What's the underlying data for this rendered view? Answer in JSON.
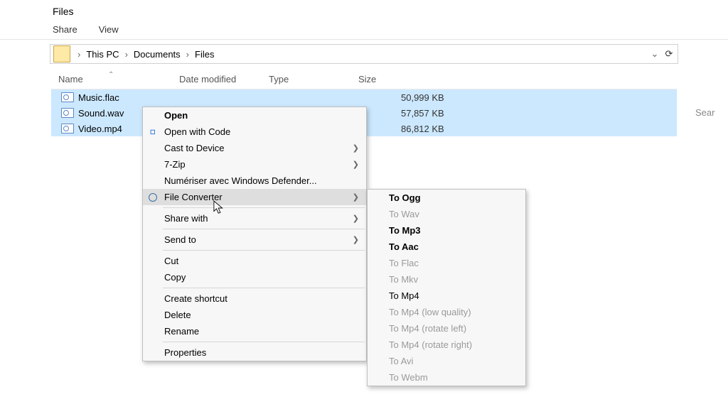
{
  "title": "Files",
  "ribbon": {
    "share": "Share",
    "view": "View"
  },
  "breadcrumb": {
    "parts": [
      "This PC",
      "Documents",
      "Files"
    ]
  },
  "search": {
    "placeholder": "Sear"
  },
  "columns": {
    "name": "Name",
    "date": "Date modified",
    "type": "Type",
    "size": "Size"
  },
  "files": [
    {
      "name": "Music.flac",
      "size": "50,999 KB"
    },
    {
      "name": "Sound.wav",
      "size": "57,857 KB"
    },
    {
      "name": "Video.mp4",
      "size": "86,812 KB"
    }
  ],
  "menu": {
    "open": "Open",
    "open_with_code": "Open with Code",
    "cast": "Cast to Device",
    "sevenzip": "7-Zip",
    "defender": "Numériser avec Windows Defender...",
    "file_converter": "File Converter",
    "share_with": "Share with",
    "send_to": "Send to",
    "cut": "Cut",
    "copy": "Copy",
    "create_shortcut": "Create shortcut",
    "delete": "Delete",
    "rename": "Rename",
    "properties": "Properties"
  },
  "submenu": {
    "to_ogg": "To Ogg",
    "to_wav": "To Wav",
    "to_mp3": "To Mp3",
    "to_aac": "To Aac",
    "to_flac": "To Flac",
    "to_mkv": "To Mkv",
    "to_mp4": "To Mp4",
    "to_mp4_low": "To Mp4 (low quality)",
    "to_mp4_rl": "To Mp4 (rotate left)",
    "to_mp4_rr": "To Mp4 (rotate right)",
    "to_avi": "To Avi",
    "to_webm": "To Webm"
  }
}
